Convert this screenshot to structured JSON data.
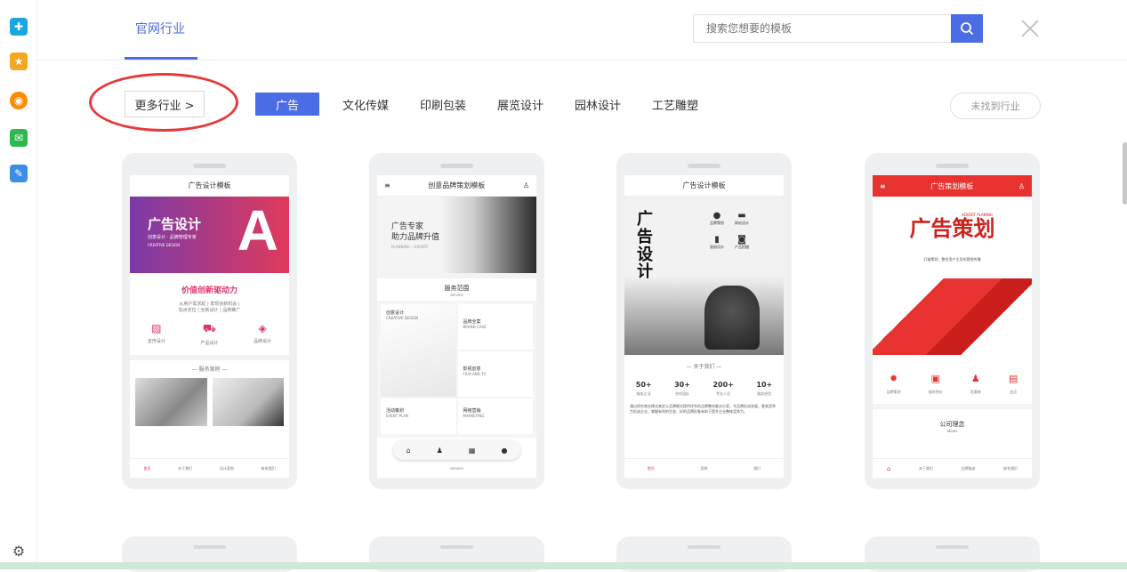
{
  "header": {
    "active_tab": "官网行业",
    "search_placeholder": "搜索您想要的模板"
  },
  "filters": {
    "more_label": "更多行业 >",
    "categories": [
      "广告",
      "文化传媒",
      "印刷包装",
      "展览设计",
      "园林设计",
      "工艺雕塑"
    ],
    "not_found_label": "未找到行业"
  },
  "templates": [
    {
      "title": "广告设计模板",
      "banner_big": "广告设计",
      "banner_sub": "创意设计 · 品牌管理专家",
      "banner_en": "CREATIVE DESIGN",
      "slogan": "价值创新驱动力",
      "desc1": "从用户需求起 | 发现创新机会 |",
      "desc2": "站点定位 | 全新设计 | 品牌推广",
      "icons": [
        "宣传设计",
        "产品设计",
        "品牌设计"
      ],
      "section": "— 服务案例 —",
      "nav": [
        "首页",
        "关于我们",
        "设计案例",
        "联系我们"
      ]
    },
    {
      "title": "创意品牌策划模板",
      "banner_l1": "广告专家",
      "banner_l2": "助力品牌升值",
      "banner_en": "PLANNING —EXPERT",
      "section": "服务范围",
      "section_en": "service",
      "tiles": [
        {
          "cn": "创意设计",
          "en": "CREATIVE DESIGN"
        },
        {
          "cn": "品牌全案",
          "en": "BRAND CASE"
        },
        {
          "cn": "影视创意",
          "en": "FILM AND TV"
        },
        {
          "cn": "活动策划",
          "en": "EVENT PLAN"
        },
        {
          "cn": "网络营销",
          "en": "MARKETING"
        }
      ],
      "footer_en": "service"
    },
    {
      "title": "广告设计模板",
      "vertical": "广告设计",
      "icons": [
        "品牌策划",
        "网站设计",
        "画册设计",
        "产品拍摄"
      ],
      "section": "— 关于我们 —",
      "stats": [
        {
          "num": "50+",
          "label": "服务企业"
        },
        {
          "num": "30+",
          "label": "合作团队"
        },
        {
          "num": "200+",
          "label": "专业人员"
        },
        {
          "num": "10+",
          "label": "服务经验"
        }
      ],
      "about": "通过研究商业模式来定义品牌模式提供优秀的品牌整合解决方案，令品牌形成发展，更具竞争力形成企业，掌握有利的生态，好的品牌形象有助于提升企业整体竞争力。",
      "nav": [
        "首页",
        "案例",
        "我们"
      ]
    },
    {
      "title": "广告策划模板",
      "big": "广告策划",
      "tag_en": "ADVERT PLANING",
      "sub": "打破策划、整合用户主导的营销传播",
      "icons": [
        "品牌策划",
        "限时特价",
        "优惠券",
        "会员"
      ],
      "idea": "公司理念",
      "idea_en": "Ideals",
      "nav": [
        "关于我们",
        "品牌服务",
        "联系我们"
      ]
    }
  ],
  "colors": {
    "accent": "#4a6de5",
    "highlight_circle": "#e53a3a",
    "red_template": "#e8322f"
  }
}
